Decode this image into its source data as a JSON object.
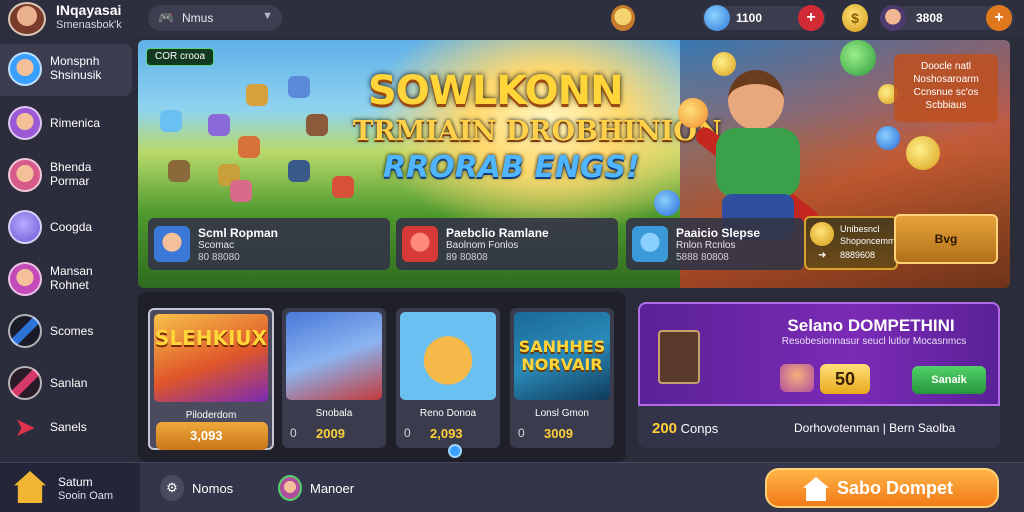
{
  "header": {
    "user_name": "INqayasai",
    "user_sub": "Smenasbok'k",
    "search_label": "Nmus",
    "currency1_value": "1100",
    "currency1_plus": "+",
    "coin_symbol": "$",
    "currency2_value": "3808",
    "currency2_plus": "+"
  },
  "sidebar": {
    "items": [
      {
        "label": "Monspnh Shsinusik",
        "icon": "character-icon",
        "color": "#3aa0ff"
      },
      {
        "label": "Rimenica",
        "icon": "knight-icon",
        "color": "#9b59d6"
      },
      {
        "label": "Bhenda Pormar",
        "icon": "hero-icon",
        "color": "#d65a8a"
      },
      {
        "label": "Coogda",
        "icon": "orb-icon",
        "color": "#6a5ad6"
      },
      {
        "label": "Mansan Rohnet",
        "icon": "warrior-icon",
        "color": "#c44ab8"
      },
      {
        "label": "Scomes",
        "icon": "feather-icon",
        "color": "#2e74d8"
      },
      {
        "label": "Sanlan",
        "icon": "sword-icon",
        "color": "#d63a6a"
      },
      {
        "label": "Sanels",
        "icon": "arrow-icon",
        "color": "#e0324a"
      }
    ]
  },
  "hero": {
    "event_tag": "COR crooa",
    "title": "SOWLKONN",
    "subtitle1": "TRMIAIN DROBHINION",
    "subtitle2": "RRORAB ENGS!",
    "promo_lines": [
      "Doocle natl",
      "Noshosaroarm",
      "Ccnsnue sc'os",
      "Scbbiaus"
    ],
    "cards": [
      {
        "title": "Scml Ropman",
        "sub": "Scomac",
        "num": "80 88080",
        "color": "#3a78d8"
      },
      {
        "title": "Paebclio Ramlane",
        "sub": "Baolnom Fonlos",
        "num": "89 80808",
        "color": "#d83a3a"
      },
      {
        "title": "Paaicio Slepse",
        "sub": "Rnlon Rcnlos",
        "num": "5888 80808",
        "color": "#3a9ad8"
      }
    ],
    "gold_card": {
      "line1": "Unibesncl",
      "line2": "Shoponcemm",
      "line3": "8889608"
    },
    "buy_label": "Bvg"
  },
  "games": [
    {
      "title": "SLEHKIUX",
      "name": "Piloderdom",
      "value": "3,093",
      "color1": "#f28a2a",
      "color2": "#7a2ab6"
    },
    {
      "title": "",
      "name": "Snobala",
      "value": "2009",
      "zero": "0",
      "color1": "#4a78d8",
      "color2": "#c43a3a"
    },
    {
      "title": "",
      "name": "Reno Donoa",
      "value": "2,093",
      "zero": "0",
      "color1": "#6ac0f0",
      "color2": "#e8a72a"
    },
    {
      "title": "SANHHES NORVAIR",
      "name": "Lonsl Gmon",
      "value": "3009",
      "zero": "0",
      "color1": "#2a8ab8",
      "color2": "#e6b43a"
    }
  ],
  "season": {
    "title": "Selano DOMPETHINI",
    "subtitle": "Resobesionnasur seucl lutlor Mocasnmcs",
    "amount": "50",
    "claim_label": "Sanaik",
    "count": "200",
    "count_label": "Conps",
    "footer": "Dorhovotenman | Bern Saolba"
  },
  "bottom": {
    "home_title": "Satum",
    "home_sub": "Sooin Oam",
    "nav1": "Nomos",
    "nav2": "Manoer",
    "cta": "Sabo Dompet"
  },
  "colors": {
    "background": "#2b2c3a",
    "accent_orange": "#f07a18",
    "accent_purple": "#7b2bb6",
    "gold": "#ffd03a"
  }
}
